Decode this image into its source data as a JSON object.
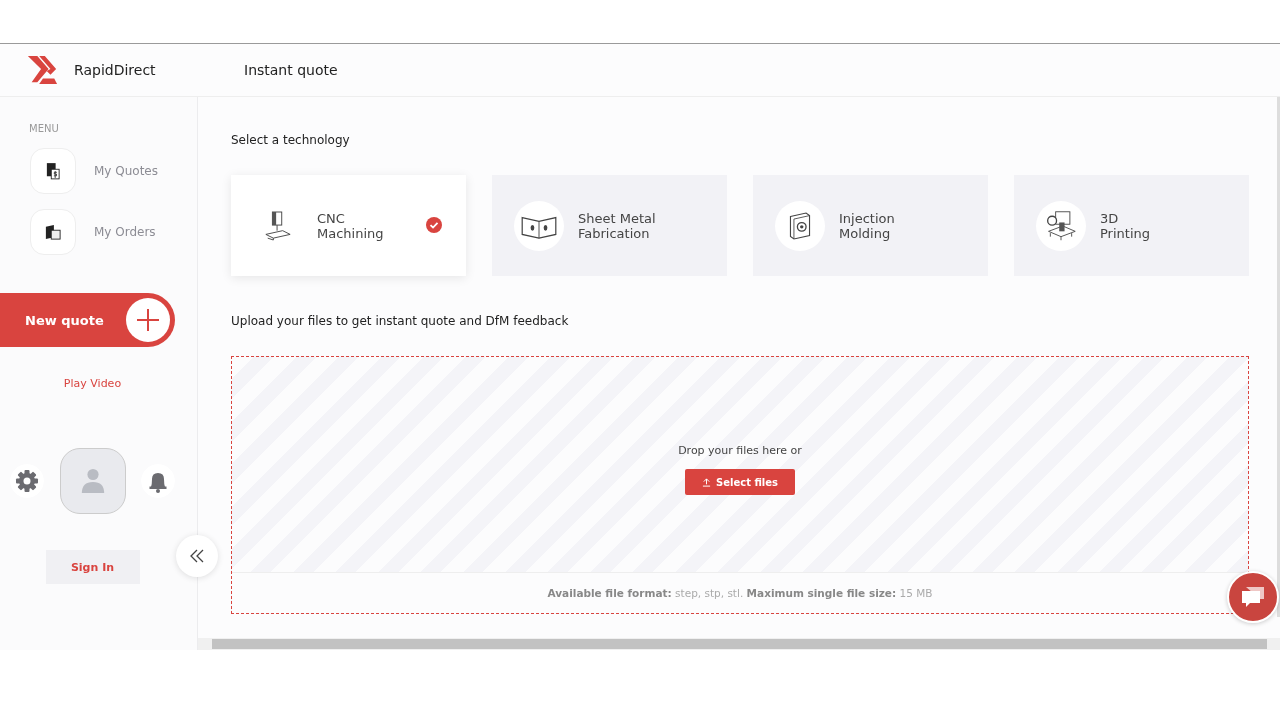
{
  "brand": "RapidDirect",
  "page_title": "Instant quote",
  "sidebar": {
    "menu_label": "MENU",
    "items": [
      {
        "label": "My Quotes",
        "kind": "quotes"
      },
      {
        "label": "My Orders",
        "kind": "orders"
      }
    ],
    "new_quote": "New quote",
    "play_video": "Play Video",
    "sign_in": "Sign In"
  },
  "technology_title": "Select a technology",
  "technologies": [
    {
      "label": "CNC\nMachining",
      "kind": "cnc",
      "selected": true
    },
    {
      "label": "Sheet Metal\nFabrication",
      "kind": "sheet",
      "selected": false
    },
    {
      "label": "Injection\nMolding",
      "kind": "mold",
      "selected": false
    },
    {
      "label": "3D\nPrinting",
      "kind": "print",
      "selected": false
    }
  ],
  "upload_title": "Upload your files to get instant quote and DfM feedback",
  "drop_text": "Drop your files here or",
  "select_button": "Select files",
  "file_note": "**Available file format:** step, stp, stl. **Maximum single file size:** 15 MB"
}
